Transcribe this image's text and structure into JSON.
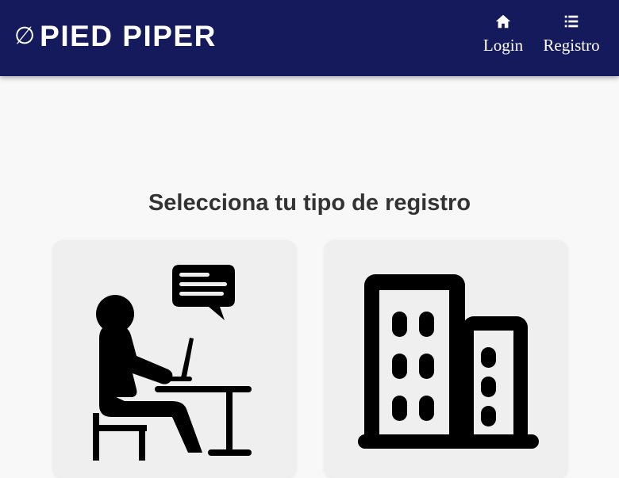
{
  "brand": {
    "symbol": "∅",
    "name": "PIED PIPER"
  },
  "nav": {
    "items": [
      {
        "label": "Login",
        "icon": "home-icon"
      },
      {
        "label": "Registro",
        "icon": "list-icon"
      }
    ]
  },
  "main": {
    "title": "Selecciona tu tipo de registro",
    "cards": [
      {
        "icon": "person-at-desk-icon"
      },
      {
        "icon": "building-icon"
      }
    ]
  },
  "colors": {
    "navbar": "#141a5c",
    "background": "#f8f8f8",
    "card": "#efefef",
    "title": "#333333"
  }
}
